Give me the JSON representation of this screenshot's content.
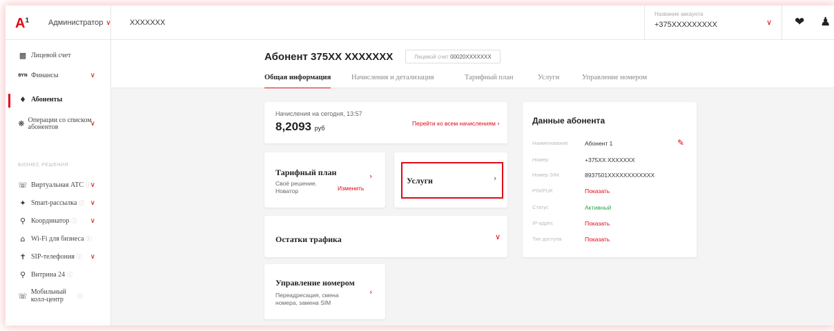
{
  "header": {
    "logo": "A",
    "logo_sup": "1",
    "role": "Администратор",
    "account": "XXXXXXX",
    "account_selector_label": "Название аккаунта",
    "account_selector_value": "+375XXXXXXXXX"
  },
  "sidebar": {
    "items": [
      {
        "label": "Лицевой счет",
        "icon": "ledger-icon"
      },
      {
        "label": "Финансы",
        "icon": "byn-icon"
      },
      {
        "label": "Абоненты",
        "icon": "users-icon"
      },
      {
        "label": "Операции со списком абонентов",
        "icon": "operations-icon"
      }
    ],
    "section_label": "БИЗНЕС РЕШЕНИЯ",
    "business_items": [
      {
        "label": "Виртуальная АТС",
        "icon": "pbx-icon"
      },
      {
        "label": "Smart-рассылка",
        "icon": "broadcast-icon"
      },
      {
        "label": "Координатор",
        "icon": "coordinator-icon"
      },
      {
        "label": "Wi-Fi для бизнеса",
        "icon": "wifi-icon"
      },
      {
        "label": "SIP-телефония",
        "icon": "sip-icon"
      },
      {
        "label": "Витрина 24",
        "icon": "showcase-icon"
      },
      {
        "label": "Мобильный колл-центр",
        "icon": "callcenter-icon"
      }
    ]
  },
  "page": {
    "title": "Абонент 375XX XXXXXXX",
    "license_label": "Лицевой счет",
    "license_value": "00020XXXXXXX"
  },
  "tabs": [
    "Общая информация",
    "Начисления и детализация",
    "Тарифный план",
    "Услуги",
    "Управление номером"
  ],
  "charges": {
    "label": "Начисления на сегодня, 13:57",
    "amount": "8,2093",
    "currency": "руб",
    "link": "Перейти ко всем начислениям"
  },
  "tariff": {
    "title": "Тарифный план",
    "sub": "Своё решение. Новатор",
    "action": "Изменить"
  },
  "services": {
    "title": "Услуги"
  },
  "traffic": {
    "title": "Остатки трафика"
  },
  "number_mgmt": {
    "title": "Управление номером",
    "sub": "Переадресация, смена номера, замена SIM"
  },
  "subscriber": {
    "title": "Данные абонента",
    "rows": [
      {
        "key": "Наименование",
        "value": "Абонент 1"
      },
      {
        "key": "Номер",
        "value": "+375XX XXXXXXX"
      },
      {
        "key": "Номер SIM",
        "value": "8937501XXXXXXXXXXXX"
      },
      {
        "key": "PIN/PUK",
        "value": "Показать"
      },
      {
        "key": "Статус",
        "value": "Активный"
      },
      {
        "key": "IP-адрес",
        "value": "Показать"
      },
      {
        "key": "Тип доступа",
        "value": "Показать"
      }
    ]
  },
  "colors": {
    "accent": "#e30613",
    "active_status": "#2ca44a"
  }
}
